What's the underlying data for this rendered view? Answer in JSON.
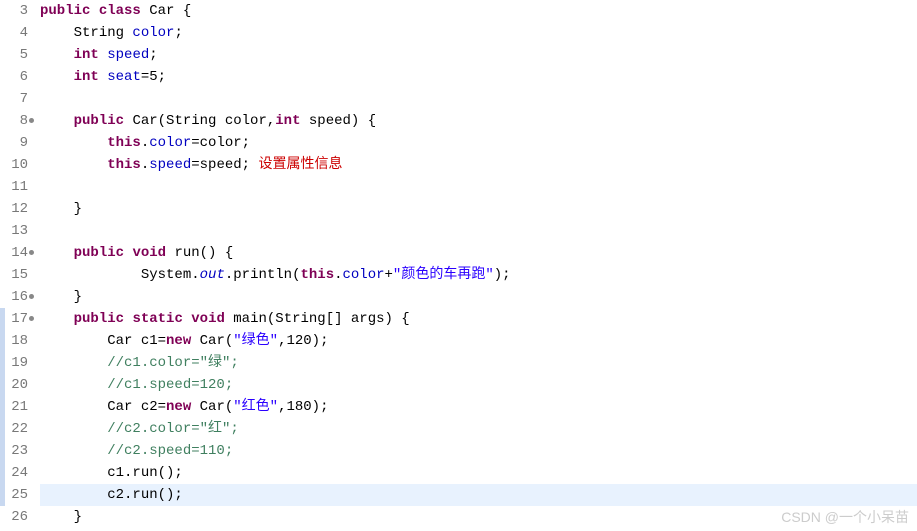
{
  "lines": [
    {
      "num": 3,
      "tokens": [
        {
          "t": "kw",
          "v": "public"
        },
        {
          "t": "sp",
          "v": " "
        },
        {
          "t": "kw",
          "v": "class"
        },
        {
          "t": "sp",
          "v": " "
        },
        {
          "t": "ident",
          "v": "Car {"
        }
      ]
    },
    {
      "num": 4,
      "indent": "    ",
      "tokens": [
        {
          "t": "ident",
          "v": "String "
        },
        {
          "t": "field",
          "v": "color"
        },
        {
          "t": "ident",
          "v": ";"
        }
      ]
    },
    {
      "num": 5,
      "indent": "    ",
      "tokens": [
        {
          "t": "kw",
          "v": "int"
        },
        {
          "t": "sp",
          "v": " "
        },
        {
          "t": "field",
          "v": "speed"
        },
        {
          "t": "ident",
          "v": ";"
        }
      ]
    },
    {
      "num": 6,
      "indent": "    ",
      "tokens": [
        {
          "t": "kw",
          "v": "int"
        },
        {
          "t": "sp",
          "v": " "
        },
        {
          "t": "field",
          "v": "seat"
        },
        {
          "t": "ident",
          "v": "=5;"
        }
      ]
    },
    {
      "num": 7,
      "tokens": []
    },
    {
      "num": 8,
      "marker": true,
      "indent": "    ",
      "tokens": [
        {
          "t": "kw",
          "v": "public"
        },
        {
          "t": "sp",
          "v": " "
        },
        {
          "t": "ident",
          "v": "Car(String color,"
        },
        {
          "t": "kw",
          "v": "int"
        },
        {
          "t": "ident",
          "v": " speed) {"
        }
      ]
    },
    {
      "num": 9,
      "indent": "        ",
      "tokens": [
        {
          "t": "kw",
          "v": "this"
        },
        {
          "t": "ident",
          "v": "."
        },
        {
          "t": "field",
          "v": "color"
        },
        {
          "t": "ident",
          "v": "=color;"
        }
      ]
    },
    {
      "num": 10,
      "indent": "        ",
      "tokens": [
        {
          "t": "kw",
          "v": "this"
        },
        {
          "t": "ident",
          "v": "."
        },
        {
          "t": "field",
          "v": "speed"
        },
        {
          "t": "ident",
          "v": "=speed; "
        }
      ],
      "annotation": "设置属性信息"
    },
    {
      "num": 11,
      "tokens": []
    },
    {
      "num": 12,
      "indent": "    ",
      "tokens": [
        {
          "t": "ident",
          "v": "}"
        }
      ]
    },
    {
      "num": 13,
      "tokens": []
    },
    {
      "num": 14,
      "marker": true,
      "indent": "    ",
      "tokens": [
        {
          "t": "kw",
          "v": "public"
        },
        {
          "t": "sp",
          "v": " "
        },
        {
          "t": "kw",
          "v": "void"
        },
        {
          "t": "sp",
          "v": " "
        },
        {
          "t": "ident",
          "v": "run() {"
        }
      ]
    },
    {
      "num": 15,
      "indent": "            ",
      "tokens": [
        {
          "t": "ident",
          "v": "System."
        },
        {
          "t": "static-field",
          "v": "out"
        },
        {
          "t": "ident",
          "v": ".println("
        },
        {
          "t": "kw",
          "v": "this"
        },
        {
          "t": "ident",
          "v": "."
        },
        {
          "t": "field",
          "v": "color"
        },
        {
          "t": "ident",
          "v": "+"
        },
        {
          "t": "str",
          "v": "\"颜色的车再跑\""
        },
        {
          "t": "ident",
          "v": ");"
        }
      ]
    },
    {
      "num": 16,
      "marker": true,
      "indent": "    ",
      "tokens": [
        {
          "t": "ident",
          "v": "}"
        }
      ]
    },
    {
      "num": 17,
      "marker": true,
      "icon_left": true,
      "indent": "    ",
      "tokens": [
        {
          "t": "kw",
          "v": "public"
        },
        {
          "t": "sp",
          "v": " "
        },
        {
          "t": "kw",
          "v": "static"
        },
        {
          "t": "sp",
          "v": " "
        },
        {
          "t": "kw",
          "v": "void"
        },
        {
          "t": "sp",
          "v": " "
        },
        {
          "t": "ident",
          "v": "main(String[] args) {"
        }
      ]
    },
    {
      "num": 18,
      "icon_left": true,
      "indent": "        ",
      "tokens": [
        {
          "t": "ident",
          "v": "Car c1="
        },
        {
          "t": "kw",
          "v": "new"
        },
        {
          "t": "ident",
          "v": " Car("
        },
        {
          "t": "str",
          "v": "\"绿色\""
        },
        {
          "t": "ident",
          "v": ",120);"
        }
      ]
    },
    {
      "num": 19,
      "icon_left": true,
      "indent": "        ",
      "tokens": [
        {
          "t": "comment",
          "v": "//c1.color=\"绿\";"
        }
      ]
    },
    {
      "num": 20,
      "icon_left": true,
      "indent": "        ",
      "tokens": [
        {
          "t": "comment",
          "v": "//c1.speed=120;"
        }
      ]
    },
    {
      "num": 21,
      "icon_left": true,
      "indent": "        ",
      "tokens": [
        {
          "t": "ident",
          "v": "Car c2="
        },
        {
          "t": "kw",
          "v": "new"
        },
        {
          "t": "ident",
          "v": " Car("
        },
        {
          "t": "str",
          "v": "\"红色\""
        },
        {
          "t": "ident",
          "v": ",180);"
        }
      ]
    },
    {
      "num": 22,
      "icon_left": true,
      "indent": "        ",
      "tokens": [
        {
          "t": "comment",
          "v": "//c2.color=\"红\";"
        }
      ]
    },
    {
      "num": 23,
      "icon_left": true,
      "indent": "        ",
      "tokens": [
        {
          "t": "comment",
          "v": "//c2.speed=110;"
        }
      ]
    },
    {
      "num": 24,
      "icon_left": true,
      "indent": "        ",
      "tokens": [
        {
          "t": "ident",
          "v": "c1.run();"
        }
      ]
    },
    {
      "num": 25,
      "icon_left": true,
      "highlighted": true,
      "indent": "        ",
      "tokens": [
        {
          "t": "ident",
          "v": "c2.run();"
        }
      ]
    },
    {
      "num": 26,
      "indent": "    ",
      "tokens": [
        {
          "t": "ident",
          "v": "}"
        }
      ]
    }
  ],
  "watermark": "CSDN @一个小呆苗"
}
